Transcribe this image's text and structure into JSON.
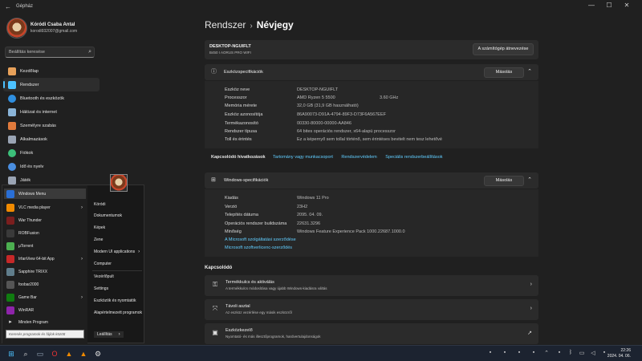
{
  "window": {
    "title": "Gépház"
  },
  "profile": {
    "name": "Kóródi Csaba Antal",
    "email": "korodi932007@gmail.com"
  },
  "sidebar": {
    "search_placeholder": "Beállítás keresése",
    "items": [
      {
        "label": "Kezdőlap",
        "icon": "home-icon",
        "color": "#e8a15a"
      },
      {
        "label": "Rendszer",
        "icon": "system-icon",
        "color": "#4cc2ff"
      },
      {
        "label": "Bluetooth és eszközök",
        "icon": "bluetooth-icon",
        "color": "#2f8fe0"
      },
      {
        "label": "Hálózat és internet",
        "icon": "network-icon",
        "color": "#8ab4d8"
      },
      {
        "label": "Személyre szabás",
        "icon": "brush-icon",
        "color": "#e07a3c"
      },
      {
        "label": "Alkalmazások",
        "icon": "apps-icon",
        "color": "#9aa4b4"
      },
      {
        "label": "Fiókok",
        "icon": "accounts-icon",
        "color": "#3cc07a"
      },
      {
        "label": "Idő és nyelv",
        "icon": "time-language-icon",
        "color": "#4a8ee0"
      },
      {
        "label": "Játék",
        "icon": "gaming-icon",
        "color": "#9aa4b4"
      }
    ]
  },
  "breadcrumb": {
    "parent": "Rendszer",
    "current": "Névjegy"
  },
  "device": {
    "name": "DESKTOP-NGUIFLT",
    "model": "B450 I AORUS PRO WIFI",
    "rename_label": "A számítógép átnevezése"
  },
  "device_specs": {
    "title": "Eszközspecifikációk",
    "copy_label": "Másolás",
    "rows": [
      {
        "label": "Eszköz neve",
        "value": "DESKTOP-NGUIFLT",
        "extra": ""
      },
      {
        "label": "Processzor",
        "value": "AMD Ryzen 5 5500",
        "extra": "3.60 GHz"
      },
      {
        "label": "Memória mérete",
        "value": "32,0 GB (31,9 GB használható)",
        "extra": ""
      },
      {
        "label": "Eszköz azonosítója",
        "value": "86A90073-D91A-4794-89F3-D73F6A567EEF",
        "extra": ""
      },
      {
        "label": "Termékazonosító",
        "value": "00330-80000-00000-AA846",
        "extra": ""
      },
      {
        "label": "Rendszer típusa",
        "value": "64 bites operációs rendszer, x64-alapú processzor",
        "extra": ""
      },
      {
        "label": "Toll és érintés",
        "value": "Ez a képernyő sem tollal történő, sem érintéses bevitelt nem tesz lehetővé",
        "extra": ""
      }
    ]
  },
  "related_links": {
    "label": "Kapcsolódó hivatkozások",
    "links": [
      "Tartomány vagy munkacsoport",
      "Rendszervédelem",
      "Speciális rendszerbeállítások"
    ]
  },
  "windows_specs": {
    "title": "Windows-specifikációk",
    "copy_label": "Másolás",
    "rows": [
      {
        "label": "Kiadás",
        "value": "Windows 11 Pro"
      },
      {
        "label": "Verzió",
        "value": "23H2"
      },
      {
        "label": "Telepítés dátuma",
        "value": "2095. 04. 09."
      },
      {
        "label": "Operációs rendszer buildszáma",
        "value": "22631.3296"
      },
      {
        "label": "Minőség",
        "value": "Windows Feature Experience Pack 1000.22687.1000.0"
      }
    ],
    "links": [
      "A Microsoft szolgáltatási szerződése",
      "Microsoft szoftverlicenc-szerződés"
    ]
  },
  "related": {
    "title": "Kapcsolódó",
    "items": [
      {
        "title": "Termékkulcs és aktiválás",
        "subtitle": "A termékkulcs módosítása vagy újabb Windows-kiadásra váltás",
        "icon": "key-icon",
        "action": "›"
      },
      {
        "title": "Távoli asztal",
        "subtitle": "Az eszköz vezérlése egy másik eszközről",
        "icon": "remote-desktop-icon",
        "action": "›"
      },
      {
        "title": "Eszközkezelő",
        "subtitle": "Nyomtató- és más illesztőprogramok, hardvertulajdonságok",
        "icon": "device-manager-icon",
        "action": "↗"
      }
    ]
  },
  "start_menu": {
    "apps": [
      {
        "label": "Windows Menu",
        "icon": "windows-menu-icon",
        "color": "#2a6fd6",
        "arrow": ""
      },
      {
        "label": "VLC media player",
        "icon": "vlc-icon",
        "color": "#f08a00",
        "arrow": "›"
      },
      {
        "label": "War Thunder",
        "icon": "war-thunder-icon",
        "color": "#7a1e1e",
        "arrow": ""
      },
      {
        "label": "ROBFusion",
        "icon": "robfusion-icon",
        "color": "#3a3a3a",
        "arrow": ""
      },
      {
        "label": "µTorrent",
        "icon": "utorrent-icon",
        "color": "#4caf50",
        "arrow": ""
      },
      {
        "label": "IrfanView 64-bit App",
        "icon": "irfanview-icon",
        "color": "#c62828",
        "arrow": "›"
      },
      {
        "label": "Sapphire TRIXX",
        "icon": "sapphire-trixx-icon",
        "color": "#607d8b",
        "arrow": ""
      },
      {
        "label": "foobar2000",
        "icon": "foobar-icon",
        "color": "#555555",
        "arrow": ""
      },
      {
        "label": "Game Bar",
        "icon": "game-bar-icon",
        "color": "#107c10",
        "arrow": "›"
      },
      {
        "label": "WinRAR",
        "icon": "winrar-icon",
        "color": "#8e24aa",
        "arrow": ""
      }
    ],
    "all_programs": "Minden Program",
    "search_placeholder": "Keresés programok és fájlok között",
    "right": [
      "Kóródi",
      "Dokumentumok",
      "Képek",
      "Zene",
      "Modern UI applications",
      "Computer",
      "Vezérlőpult",
      "Settings",
      "Eszközök és nyomtatók",
      "Alapértelmezett programok"
    ],
    "shutdown_label": "Leállítás"
  },
  "taskbar": {
    "time": "22:26",
    "date": "2024. 04. 06."
  }
}
